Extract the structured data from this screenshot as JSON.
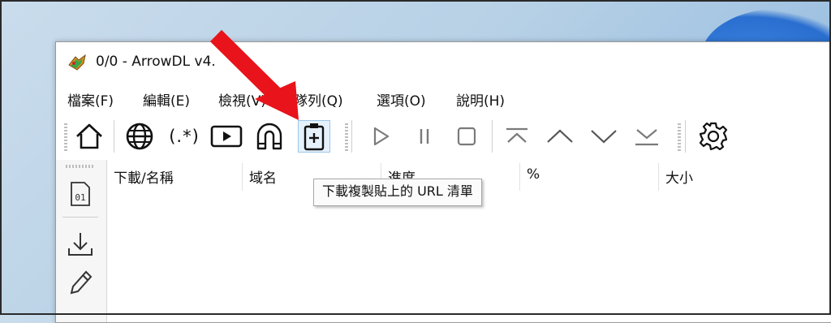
{
  "window": {
    "title": "0/0 - ArrowDL v4.",
    "app_icon": "arrowdl-logo-icon"
  },
  "menu": {
    "items": [
      "檔案(F)",
      "編輯(E)",
      "檢視(V)",
      "隊列(Q)",
      "選項(O)",
      "說明(H)"
    ]
  },
  "toolbar": {
    "buttons": [
      {
        "name": "home",
        "icon": "home-icon"
      },
      {
        "name": "web",
        "icon": "globe-icon"
      },
      {
        "name": "regex",
        "label": "(.*)"
      },
      {
        "name": "media",
        "icon": "play-box-icon"
      },
      {
        "name": "magnet",
        "icon": "magnet-icon"
      },
      {
        "name": "paste-urls",
        "icon": "clipboard-plus-icon",
        "hovered": true
      },
      {
        "name": "start",
        "icon": "play-icon"
      },
      {
        "name": "pause",
        "icon": "pause-icon"
      },
      {
        "name": "stop",
        "icon": "stop-icon"
      },
      {
        "name": "move-top",
        "icon": "move-top-icon"
      },
      {
        "name": "move-up",
        "icon": "chevron-up-icon"
      },
      {
        "name": "move-down",
        "icon": "chevron-down-icon"
      },
      {
        "name": "move-bottom",
        "icon": "move-bottom-icon"
      },
      {
        "name": "settings",
        "icon": "gear-icon"
      }
    ],
    "regex_label": "(.*)"
  },
  "tooltip": {
    "text": "下載複製貼上的 URL 清單"
  },
  "sidebar": {
    "items": [
      {
        "icon": "binary-file-icon",
        "label": "01"
      },
      {
        "icon": "download-icon"
      },
      {
        "icon": "pencil-icon"
      }
    ]
  },
  "table": {
    "columns": [
      "下載/名稱",
      "域名",
      "進度",
      "%",
      "大小"
    ]
  },
  "annotation": {
    "arrow_color": "#e8131b"
  }
}
